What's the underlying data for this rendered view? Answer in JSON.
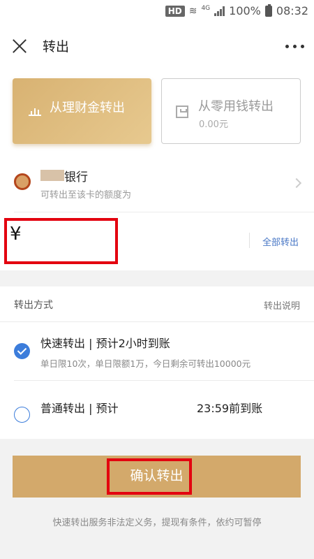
{
  "status_bar": {
    "hd_badge": "HD",
    "network": "4G",
    "battery": "100%",
    "time": "08:32"
  },
  "header": {
    "title": "转出"
  },
  "source_options": [
    {
      "label": "从理财金转出",
      "selected": true
    },
    {
      "label": "从零用钱转出",
      "sub": "0.00元",
      "selected": false
    }
  ],
  "bank": {
    "name": "银行",
    "description": "可转出至该卡的额度为"
  },
  "amount": {
    "currency_symbol": "¥",
    "value": "",
    "transfer_all_label": "全部转出"
  },
  "methods": {
    "title": "转出方式",
    "help_label": "转出说明",
    "options": [
      {
        "title": "快速转出 | 预计2小时到账",
        "description": "单日限10次，单日限额1万，今日剩余可转出10000元",
        "selected": true
      },
      {
        "title": "普通转出 | 预计",
        "title_suffix": "23:59前到账",
        "selected": false
      }
    ]
  },
  "confirm_button": {
    "label": "确认转出"
  },
  "footer_note": "快速转出服务非法定义务，提现有条件，依约可暂停",
  "colors": {
    "gold_accent": "#d3a96b",
    "link_blue": "#4a78c6",
    "radio_blue": "#3c7ddb",
    "highlight_red": "#e3000f"
  }
}
